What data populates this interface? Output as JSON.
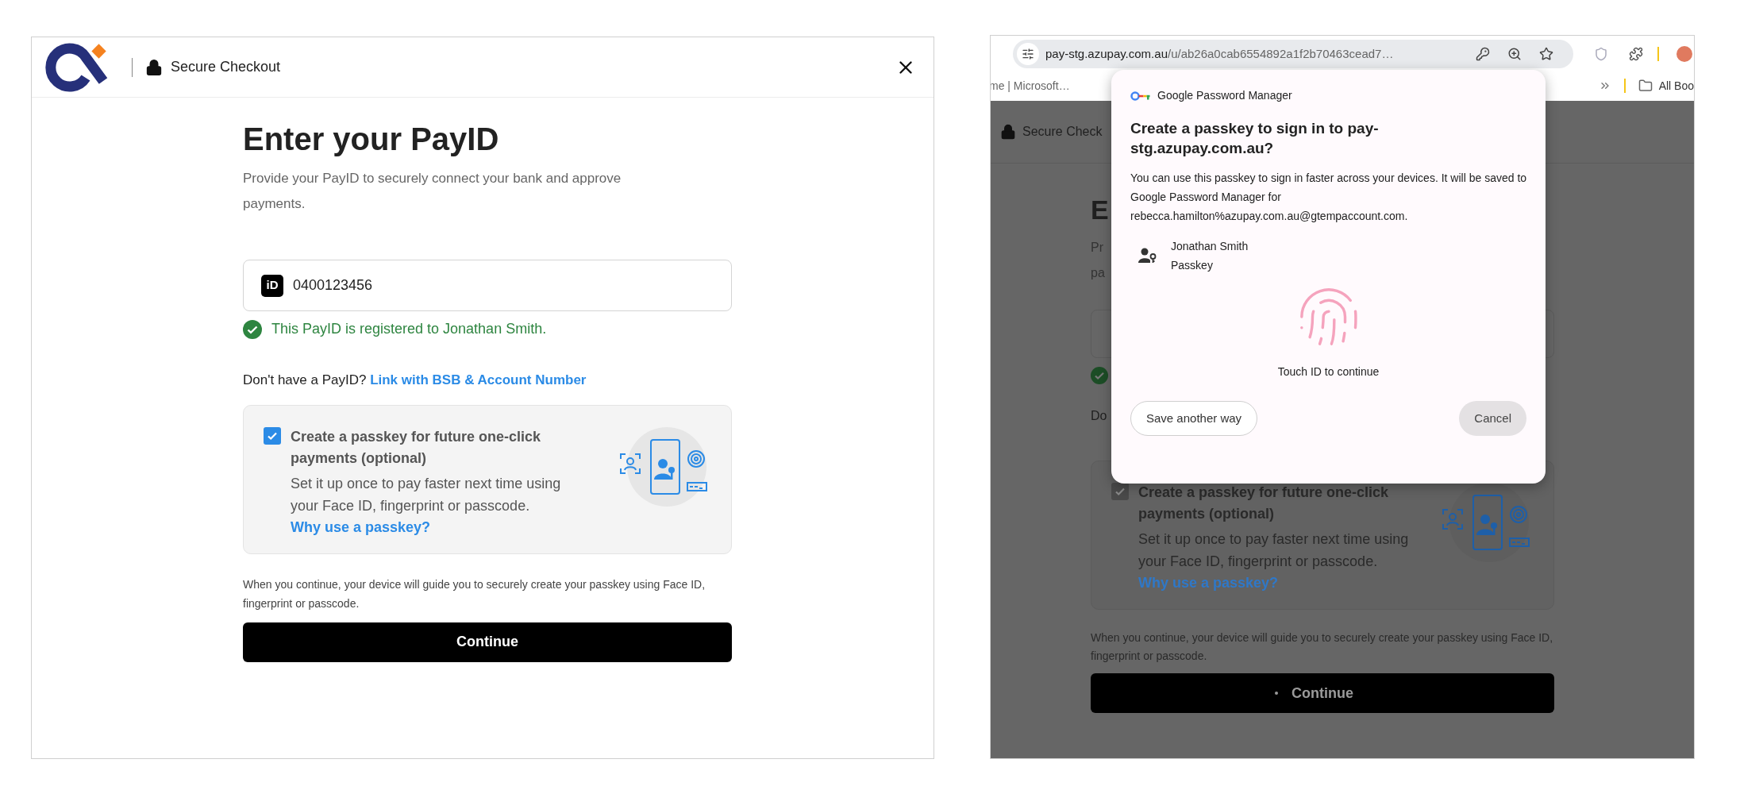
{
  "checkout": {
    "header": {
      "title": "Secure Checkout"
    },
    "heading": "Enter your PayID",
    "subtitle": "Provide your PayID to securely connect your bank and approve payments.",
    "payid_field": {
      "badge": "iD",
      "value": "0400123456"
    },
    "status": {
      "kind": "success",
      "text": "This PayID is registered to Jonathan Smith."
    },
    "link_prompt": {
      "text": "Don't have a PayID?",
      "link": "Link with BSB & Account Number"
    },
    "passkey_option": {
      "checked": true,
      "title": "Create a passkey for future one-click payments (optional)",
      "description": "Set it up once to pay faster next time using your Face ID, fingerprint or passcode.",
      "link": "Why use a passkey?"
    },
    "note": "When you continue, your device will guide you to securely create your passkey using Face ID, fingerprint or passcode.",
    "continue_button": {
      "label": "Continue",
      "loading": false
    }
  },
  "browser": {
    "address_bar": {
      "domain": "pay-stg.azupay.com.au",
      "path": "/u/ab26a0cab6554892a1f2b70463cead7…"
    },
    "bookmarks": [
      {
        "label": "me | Microsoft…"
      },
      {
        "label": "All Boo"
      }
    ],
    "page": {
      "header": "Secure Check",
      "heading": "E",
      "subtitle_lines": [
        "Pr",
        "pa"
      ],
      "prompt": "Do",
      "passkey_option": {
        "checked": true,
        "title": "Create a passkey for future one-click payments (optional)",
        "description": "Set it up once to pay faster next time using your Face ID, fingerprint or passcode.",
        "link": "Why use a passkey?"
      },
      "note": "When you continue, your device will guide you to securely create your passkey using Face ID, fingerprint or passcode.",
      "continue_button": {
        "label": "Continue",
        "loading": true
      }
    },
    "dialog": {
      "app": "Google Password Manager",
      "title": "Create a passkey to sign in to pay-stg.azupay.com.au?",
      "body": "You can use this passkey to sign in faster across your devices. It will be saved to Google Password Manager for rebecca.hamilton%azupay.com.au@gtempaccount.com.",
      "account": {
        "name": "Jonathan Smith",
        "type": "Passkey"
      },
      "prompt": "Touch ID to continue",
      "buttons": [
        {
          "kind": "outline",
          "label": "Save another way"
        },
        {
          "kind": "tonal",
          "label": "Cancel"
        }
      ]
    }
  }
}
